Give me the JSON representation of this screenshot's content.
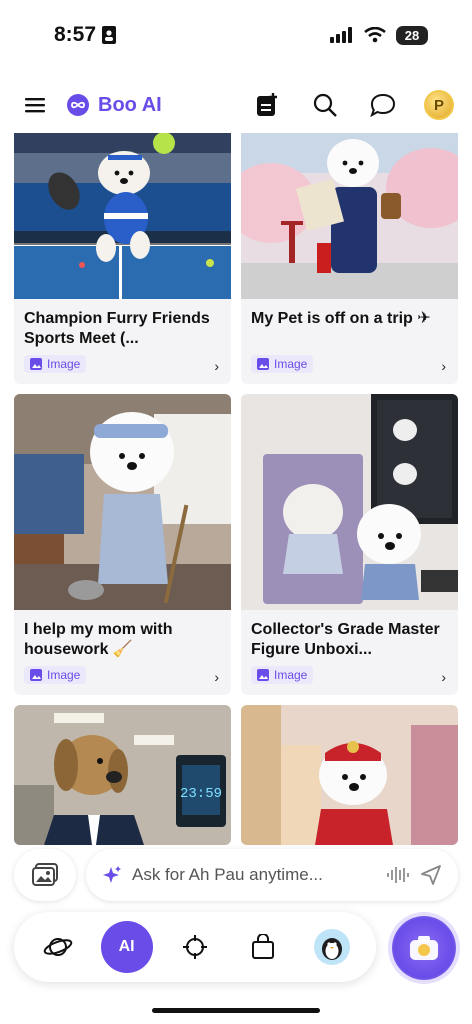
{
  "status": {
    "time": "8:57",
    "battery": "28"
  },
  "header": {
    "brand": "Boo AI"
  },
  "cards": [
    {
      "title": "Champion Furry Friends Sports Meet (...",
      "tag": "Image"
    },
    {
      "title": "My Pet is off on a trip ✈",
      "tag": "Image"
    },
    {
      "title": "I help my mom with housework 🧹",
      "tag": "Image"
    },
    {
      "title": "Collector's Grade Master Figure Unboxi...",
      "tag": "Image"
    },
    {
      "title": "",
      "tag": ""
    },
    {
      "title": "",
      "tag": ""
    }
  ],
  "clock_display": "23:59",
  "ask": {
    "placeholder": "Ask for Ah Pau anytime..."
  },
  "colors": {
    "accent": "#6a4ce8",
    "tag_bg": "#ece8fb"
  },
  "icons": {
    "menu": "menu-icon",
    "brand": "infinity-logo-icon",
    "note": "note-add-icon",
    "search": "search-icon",
    "chat": "chat-icon",
    "coin": "coin-icon",
    "gallery": "gallery-icon",
    "sparkle": "sparkle-icon",
    "voice": "voice-wave-icon",
    "send": "send-icon",
    "explore": "planet-icon",
    "ai": "ai-icon",
    "target": "crosshair-icon",
    "shop": "shopping-bag-icon",
    "profile": "penguin-avatar-icon",
    "camera": "camera-icon"
  },
  "nav": {
    "ai_label": "AI",
    "coin_label": "P"
  }
}
